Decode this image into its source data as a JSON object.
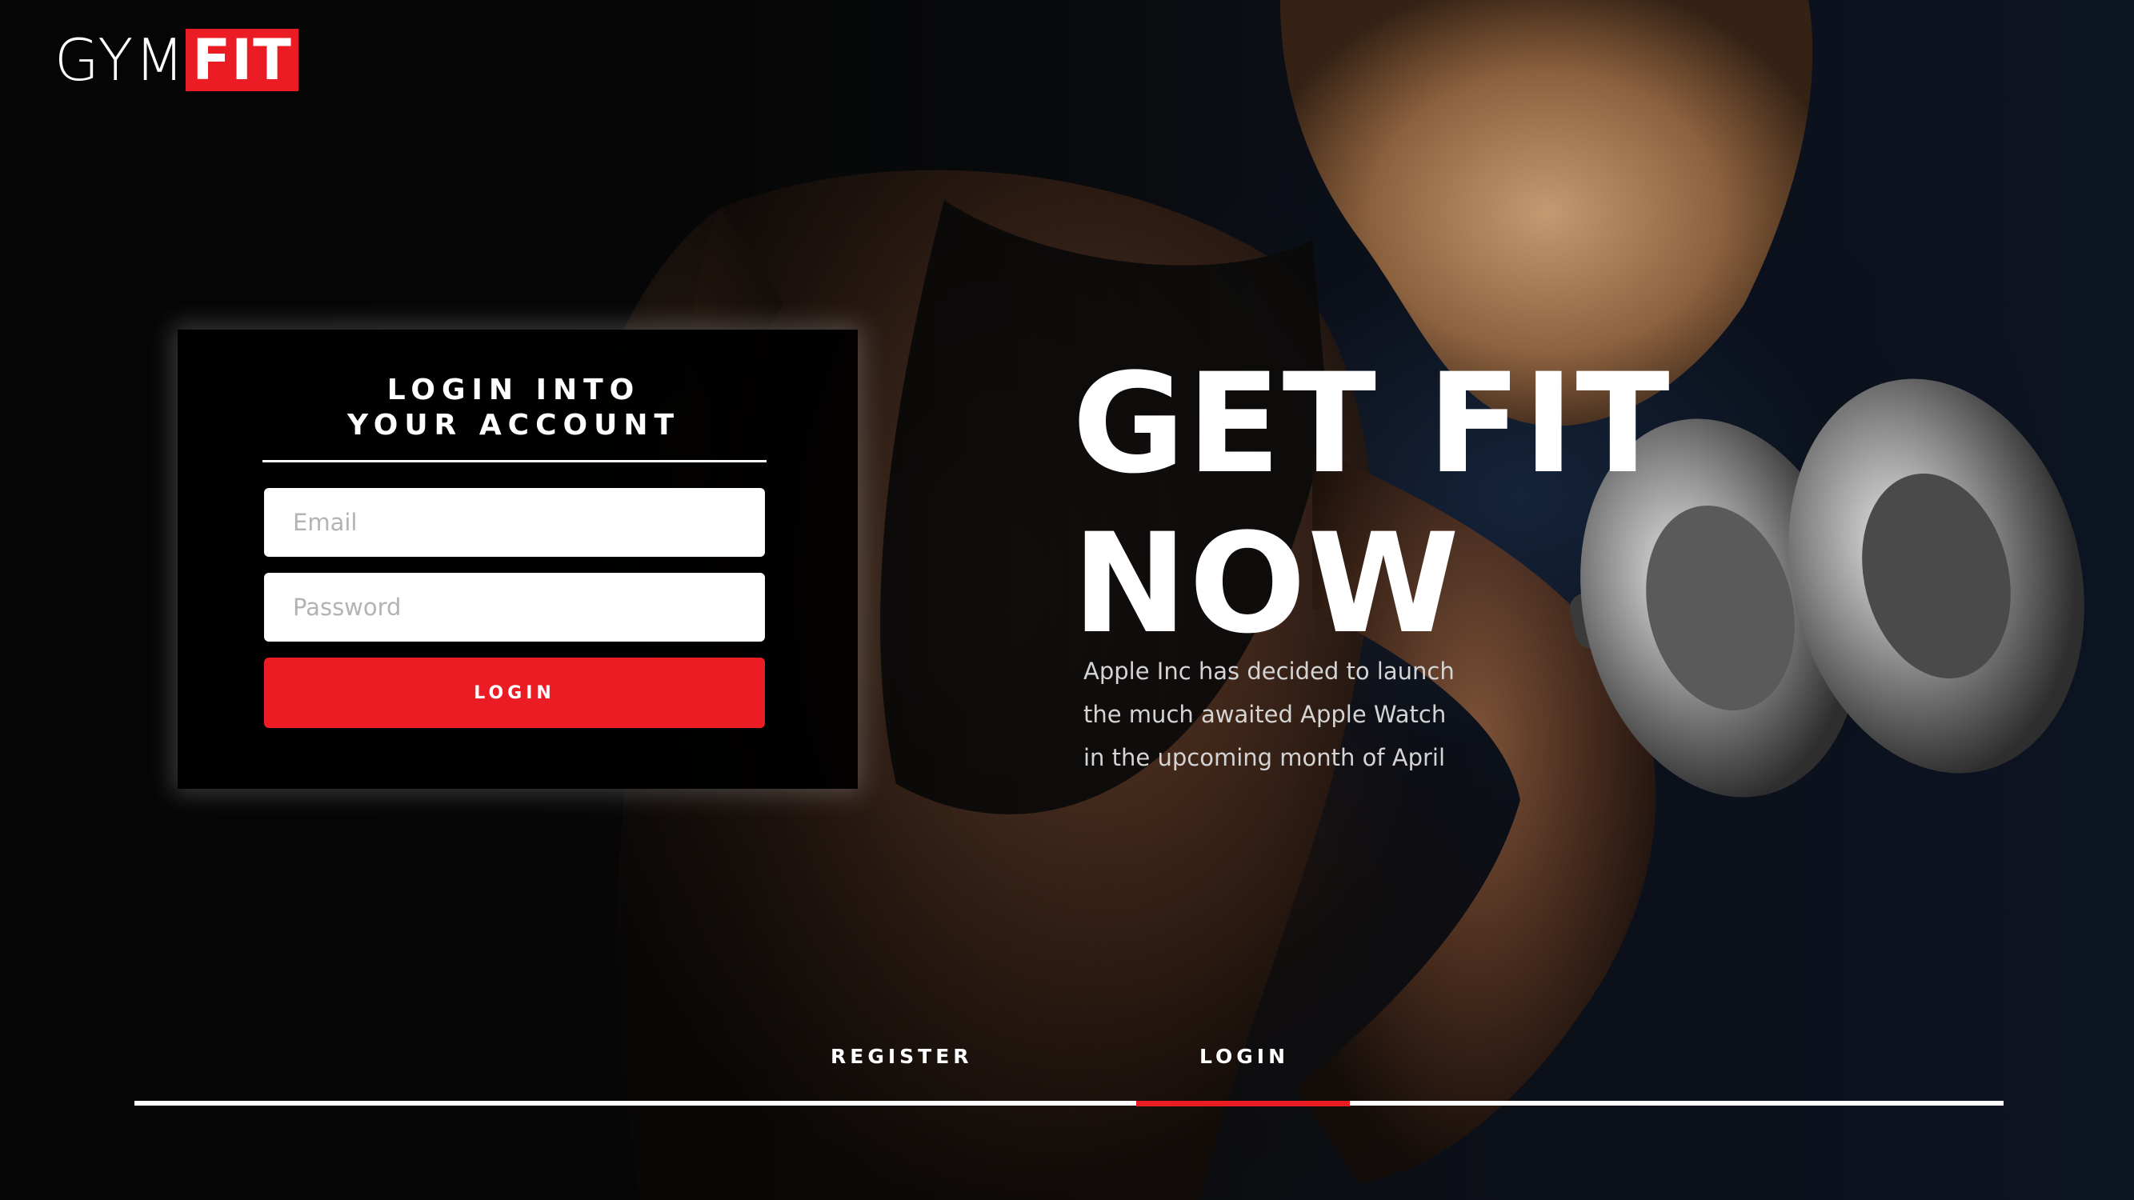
{
  "logo": {
    "part1": "GYM",
    "part2": "FIT"
  },
  "login_card": {
    "title_line1": "LOGIN INTO",
    "title_line2": "YOUR ACCOUNT",
    "email_placeholder": "Email",
    "email_value": "",
    "password_placeholder": "Password",
    "password_value": "",
    "button_label": "LOGIN"
  },
  "hero": {
    "headline_line1": "GET FIT",
    "headline_line2": "NOW",
    "description_lines": [
      "Apple Inc has decided to launch",
      "the much awaited Apple Watch",
      "in the upcoming month of April"
    ]
  },
  "tabs": {
    "items": [
      {
        "label": "REGISTER",
        "active": false
      },
      {
        "label": "LOGIN",
        "active": true
      }
    ]
  },
  "colors": {
    "accent": "#ec1c24",
    "background": "#050505",
    "text": "#ffffff",
    "muted_text": "#d4d4d4"
  },
  "icons": {
    "background_image": "woman-lifting-dumbbell-photo"
  }
}
